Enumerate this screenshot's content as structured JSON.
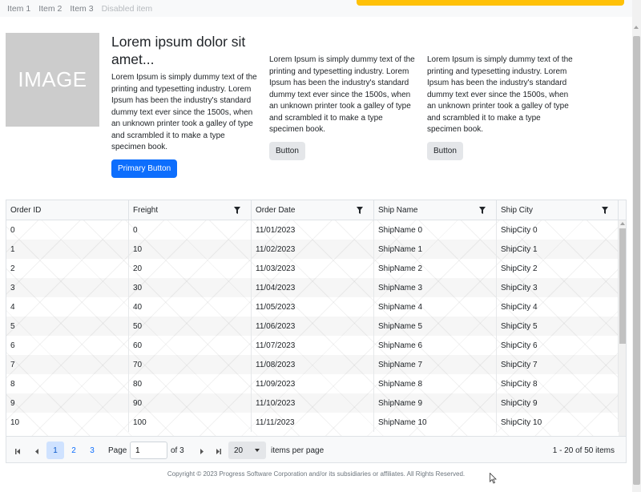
{
  "nav": {
    "items": [
      {
        "label": "Item 1"
      },
      {
        "label": "Item 2"
      },
      {
        "label": "Item 3"
      },
      {
        "label": "Disabled item"
      }
    ]
  },
  "hero": {
    "image_text": "IMAGE",
    "title": "Lorem ipsum dolor sit amet...",
    "text": "Lorem Ipsum is simply dummy text of the printing and typesetting industry. Lorem Ipsum has been the industry's standard dummy text ever since the 1500s, when an unknown printer took a galley of type and scrambled it to make a type specimen book.",
    "primary_button": "Primary Button"
  },
  "columns": [
    {
      "text": "Lorem Ipsum is simply dummy text of the printing and typesetting industry. Lorem Ipsum has been the industry's standard dummy text ever since the 1500s, when an unknown printer took a galley of type and scrambled it to make a type specimen book.",
      "button": "Button"
    },
    {
      "text": "Lorem Ipsum is simply dummy text of the printing and typesetting industry. Lorem Ipsum has been the industry's standard dummy text ever since the 1500s, when an unknown printer took a galley of type and scrambled it to make a type specimen book.",
      "button": "Button"
    }
  ],
  "grid": {
    "headers": [
      "Order ID",
      "Freight",
      "Order Date",
      "Ship Name",
      "Ship City"
    ],
    "rows": [
      [
        "0",
        "0",
        "11/01/2023",
        "ShipName 0",
        "ShipCity 0"
      ],
      [
        "1",
        "10",
        "11/02/2023",
        "ShipName 1",
        "ShipCity 1"
      ],
      [
        "2",
        "20",
        "11/03/2023",
        "ShipName 2",
        "ShipCity 2"
      ],
      [
        "3",
        "30",
        "11/04/2023",
        "ShipName 3",
        "ShipCity 3"
      ],
      [
        "4",
        "40",
        "11/05/2023",
        "ShipName 4",
        "ShipCity 4"
      ],
      [
        "5",
        "50",
        "11/06/2023",
        "ShipName 5",
        "ShipCity 5"
      ],
      [
        "6",
        "60",
        "11/07/2023",
        "ShipName 6",
        "ShipCity 6"
      ],
      [
        "7",
        "70",
        "11/08/2023",
        "ShipName 7",
        "ShipCity 7"
      ],
      [
        "8",
        "80",
        "11/09/2023",
        "ShipName 8",
        "ShipCity 8"
      ],
      [
        "9",
        "90",
        "11/10/2023",
        "ShipName 9",
        "ShipCity 9"
      ],
      [
        "10",
        "100",
        "11/11/2023",
        "ShipName 10",
        "ShipCity 10"
      ]
    ]
  },
  "pager": {
    "pages": [
      "1",
      "2",
      "3"
    ],
    "page_label": "Page",
    "current_page": "1",
    "of_label": "of 3",
    "page_size": "20",
    "items_per_page_label": "items per page",
    "summary": "1 - 20 of 50 items"
  },
  "footer": {
    "text": "Copyright © 2023 Progress Software Corporation and/or its subsidiaries or affiliates. All Rights Reserved."
  },
  "colors": {
    "primary": "#0d6efd",
    "warning": "#ffc107",
    "secondary_button": "#e4e6e9",
    "active_page_bg": "#cfe2ff"
  }
}
